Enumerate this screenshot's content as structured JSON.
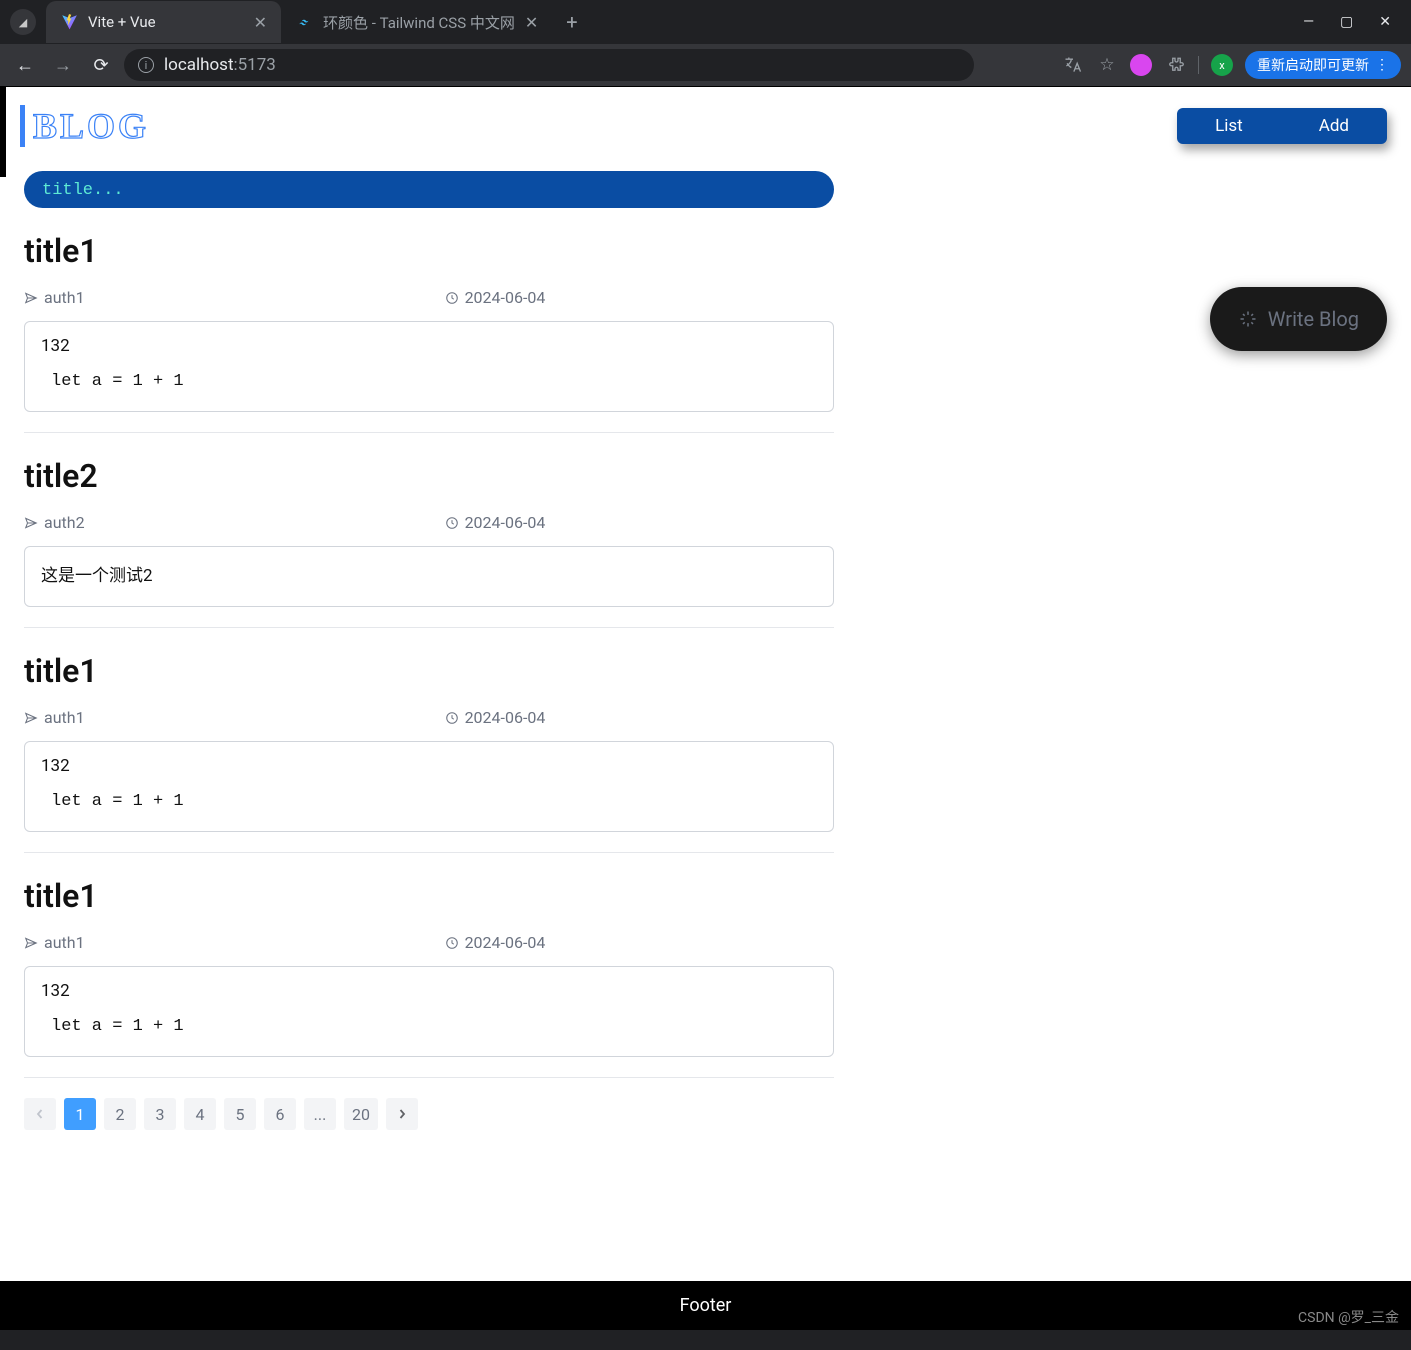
{
  "browser": {
    "tabs": [
      {
        "title": "Vite + Vue",
        "active": true
      },
      {
        "title": "环颜色 - Tailwind CSS 中文网",
        "active": false
      }
    ],
    "url_host": "localhost",
    "url_port": ":5173",
    "avatar_letter": "x",
    "relaunch_label": "重新启动即可更新"
  },
  "header": {
    "logo": "BLOG",
    "nav": {
      "list": "List",
      "add": "Add"
    }
  },
  "search": {
    "placeholder": "title..."
  },
  "write_button": "Write Blog",
  "posts": [
    {
      "title": "title1",
      "author": "auth1",
      "date": "2024-06-04",
      "text": "132",
      "code": "let a = 1 + 1"
    },
    {
      "title": "title2",
      "author": "auth2",
      "date": "2024-06-04",
      "text": "这是一个测试2",
      "code": ""
    },
    {
      "title": "title1",
      "author": "auth1",
      "date": "2024-06-04",
      "text": "132",
      "code": "let a = 1 + 1"
    },
    {
      "title": "title1",
      "author": "auth1",
      "date": "2024-06-04",
      "text": "132",
      "code": "let a = 1 + 1"
    }
  ],
  "pagination": {
    "pages": [
      "1",
      "2",
      "3",
      "4",
      "5",
      "6",
      "...",
      "20"
    ],
    "active": "1"
  },
  "footer": "Footer",
  "watermark": "CSDN @罗_三金"
}
